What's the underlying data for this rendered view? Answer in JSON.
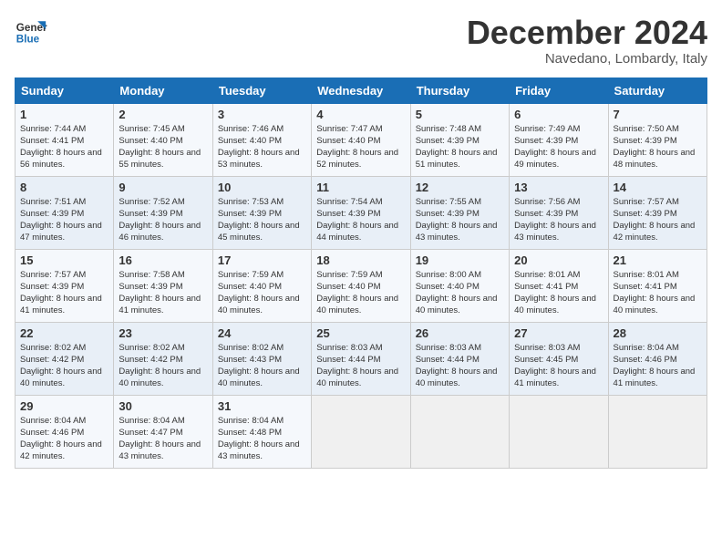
{
  "logo": {
    "line1": "General",
    "line2": "Blue"
  },
  "title": "December 2024",
  "subtitle": "Navedano, Lombardy, Italy",
  "weekdays": [
    "Sunday",
    "Monday",
    "Tuesday",
    "Wednesday",
    "Thursday",
    "Friday",
    "Saturday"
  ],
  "weeks": [
    [
      {
        "day": "1",
        "sunrise": "Sunrise: 7:44 AM",
        "sunset": "Sunset: 4:41 PM",
        "daylight": "Daylight: 8 hours and 56 minutes."
      },
      {
        "day": "2",
        "sunrise": "Sunrise: 7:45 AM",
        "sunset": "Sunset: 4:40 PM",
        "daylight": "Daylight: 8 hours and 55 minutes."
      },
      {
        "day": "3",
        "sunrise": "Sunrise: 7:46 AM",
        "sunset": "Sunset: 4:40 PM",
        "daylight": "Daylight: 8 hours and 53 minutes."
      },
      {
        "day": "4",
        "sunrise": "Sunrise: 7:47 AM",
        "sunset": "Sunset: 4:40 PM",
        "daylight": "Daylight: 8 hours and 52 minutes."
      },
      {
        "day": "5",
        "sunrise": "Sunrise: 7:48 AM",
        "sunset": "Sunset: 4:39 PM",
        "daylight": "Daylight: 8 hours and 51 minutes."
      },
      {
        "day": "6",
        "sunrise": "Sunrise: 7:49 AM",
        "sunset": "Sunset: 4:39 PM",
        "daylight": "Daylight: 8 hours and 49 minutes."
      },
      {
        "day": "7",
        "sunrise": "Sunrise: 7:50 AM",
        "sunset": "Sunset: 4:39 PM",
        "daylight": "Daylight: 8 hours and 48 minutes."
      }
    ],
    [
      {
        "day": "8",
        "sunrise": "Sunrise: 7:51 AM",
        "sunset": "Sunset: 4:39 PM",
        "daylight": "Daylight: 8 hours and 47 minutes."
      },
      {
        "day": "9",
        "sunrise": "Sunrise: 7:52 AM",
        "sunset": "Sunset: 4:39 PM",
        "daylight": "Daylight: 8 hours and 46 minutes."
      },
      {
        "day": "10",
        "sunrise": "Sunrise: 7:53 AM",
        "sunset": "Sunset: 4:39 PM",
        "daylight": "Daylight: 8 hours and 45 minutes."
      },
      {
        "day": "11",
        "sunrise": "Sunrise: 7:54 AM",
        "sunset": "Sunset: 4:39 PM",
        "daylight": "Daylight: 8 hours and 44 minutes."
      },
      {
        "day": "12",
        "sunrise": "Sunrise: 7:55 AM",
        "sunset": "Sunset: 4:39 PM",
        "daylight": "Daylight: 8 hours and 43 minutes."
      },
      {
        "day": "13",
        "sunrise": "Sunrise: 7:56 AM",
        "sunset": "Sunset: 4:39 PM",
        "daylight": "Daylight: 8 hours and 43 minutes."
      },
      {
        "day": "14",
        "sunrise": "Sunrise: 7:57 AM",
        "sunset": "Sunset: 4:39 PM",
        "daylight": "Daylight: 8 hours and 42 minutes."
      }
    ],
    [
      {
        "day": "15",
        "sunrise": "Sunrise: 7:57 AM",
        "sunset": "Sunset: 4:39 PM",
        "daylight": "Daylight: 8 hours and 41 minutes."
      },
      {
        "day": "16",
        "sunrise": "Sunrise: 7:58 AM",
        "sunset": "Sunset: 4:39 PM",
        "daylight": "Daylight: 8 hours and 41 minutes."
      },
      {
        "day": "17",
        "sunrise": "Sunrise: 7:59 AM",
        "sunset": "Sunset: 4:40 PM",
        "daylight": "Daylight: 8 hours and 40 minutes."
      },
      {
        "day": "18",
        "sunrise": "Sunrise: 7:59 AM",
        "sunset": "Sunset: 4:40 PM",
        "daylight": "Daylight: 8 hours and 40 minutes."
      },
      {
        "day": "19",
        "sunrise": "Sunrise: 8:00 AM",
        "sunset": "Sunset: 4:40 PM",
        "daylight": "Daylight: 8 hours and 40 minutes."
      },
      {
        "day": "20",
        "sunrise": "Sunrise: 8:01 AM",
        "sunset": "Sunset: 4:41 PM",
        "daylight": "Daylight: 8 hours and 40 minutes."
      },
      {
        "day": "21",
        "sunrise": "Sunrise: 8:01 AM",
        "sunset": "Sunset: 4:41 PM",
        "daylight": "Daylight: 8 hours and 40 minutes."
      }
    ],
    [
      {
        "day": "22",
        "sunrise": "Sunrise: 8:02 AM",
        "sunset": "Sunset: 4:42 PM",
        "daylight": "Daylight: 8 hours and 40 minutes."
      },
      {
        "day": "23",
        "sunrise": "Sunrise: 8:02 AM",
        "sunset": "Sunset: 4:42 PM",
        "daylight": "Daylight: 8 hours and 40 minutes."
      },
      {
        "day": "24",
        "sunrise": "Sunrise: 8:02 AM",
        "sunset": "Sunset: 4:43 PM",
        "daylight": "Daylight: 8 hours and 40 minutes."
      },
      {
        "day": "25",
        "sunrise": "Sunrise: 8:03 AM",
        "sunset": "Sunset: 4:44 PM",
        "daylight": "Daylight: 8 hours and 40 minutes."
      },
      {
        "day": "26",
        "sunrise": "Sunrise: 8:03 AM",
        "sunset": "Sunset: 4:44 PM",
        "daylight": "Daylight: 8 hours and 40 minutes."
      },
      {
        "day": "27",
        "sunrise": "Sunrise: 8:03 AM",
        "sunset": "Sunset: 4:45 PM",
        "daylight": "Daylight: 8 hours and 41 minutes."
      },
      {
        "day": "28",
        "sunrise": "Sunrise: 8:04 AM",
        "sunset": "Sunset: 4:46 PM",
        "daylight": "Daylight: 8 hours and 41 minutes."
      }
    ],
    [
      {
        "day": "29",
        "sunrise": "Sunrise: 8:04 AM",
        "sunset": "Sunset: 4:46 PM",
        "daylight": "Daylight: 8 hours and 42 minutes."
      },
      {
        "day": "30",
        "sunrise": "Sunrise: 8:04 AM",
        "sunset": "Sunset: 4:47 PM",
        "daylight": "Daylight: 8 hours and 43 minutes."
      },
      {
        "day": "31",
        "sunrise": "Sunrise: 8:04 AM",
        "sunset": "Sunset: 4:48 PM",
        "daylight": "Daylight: 8 hours and 43 minutes."
      },
      null,
      null,
      null,
      null
    ]
  ]
}
